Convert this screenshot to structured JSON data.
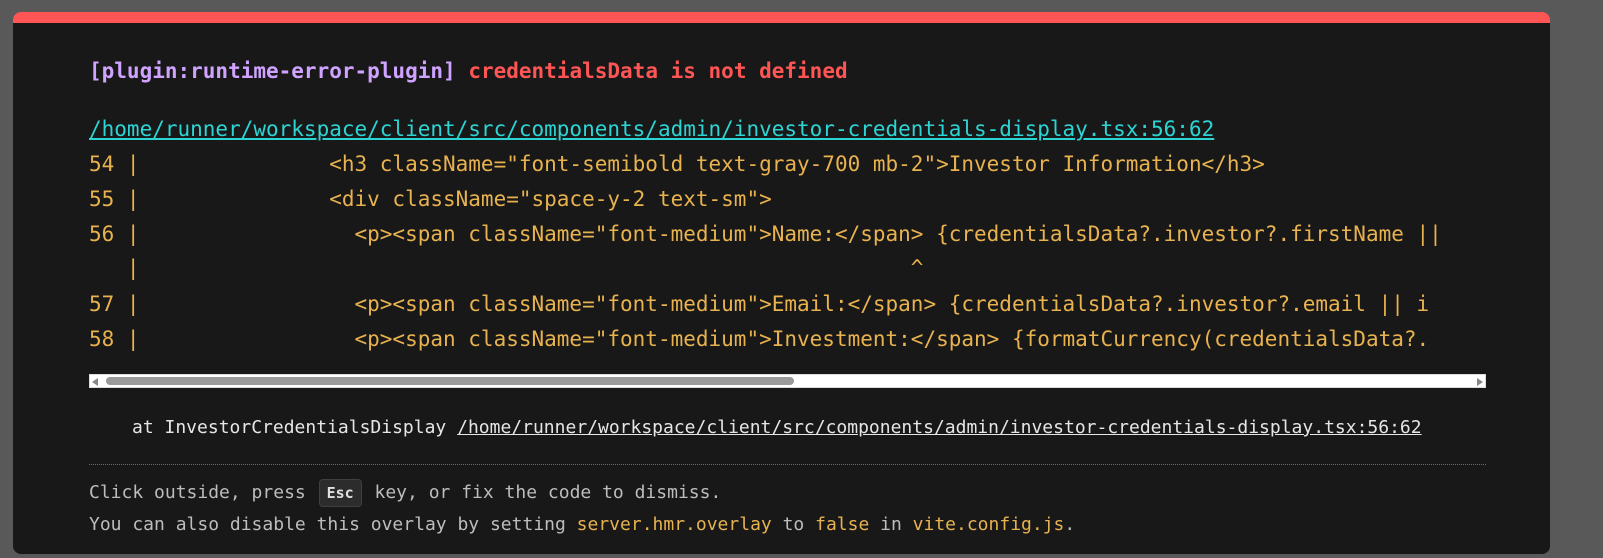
{
  "error": {
    "plugin": "[plugin:runtime-error-plugin]",
    "message": "credentialsData is not defined"
  },
  "file": {
    "path": "/home/runner/workspace/client/src/components/admin/investor-credentials-display.tsx:56:62"
  },
  "code_frame": {
    "lines": [
      "54 |               <h3 className=\"font-semibold text-gray-700 mb-2\">Investor Information</h3>",
      "55 |               <div className=\"space-y-2 text-sm\">",
      "56 |                 <p><span className=\"font-medium\">Name:</span> {credentialsData?.investor?.firstName ||",
      "   |                                                             ^",
      "57 |                 <p><span className=\"font-medium\">Email:</span> {credentialsData?.investor?.email || i",
      "58 |                 <p><span className=\"font-medium\">Investment:</span> {formatCurrency(credentialsData?."
    ]
  },
  "stack": {
    "prefix": "at InvestorCredentialsDisplay ",
    "link": "/home/runner/workspace/client/src/components/admin/investor-credentials-display.tsx:56:62"
  },
  "tip": {
    "line1_before": "Click outside, press ",
    "kbd": "Esc",
    "line1_after": " key, or fix the code to dismiss.",
    "line2_a": "You can also disable this overlay by setting ",
    "line2_code1": "server.hmr.overlay",
    "line2_b": " to ",
    "line2_code2": "false",
    "line2_c": " in ",
    "line2_code3": "vite.config.js",
    "line2_d": "."
  },
  "colors": {
    "accent_bar": "#ff5555",
    "plugin": "#cfa3ff",
    "error": "#ff5555",
    "link": "#2dd4d4",
    "code": "#e8b24f",
    "background": "#181818"
  }
}
